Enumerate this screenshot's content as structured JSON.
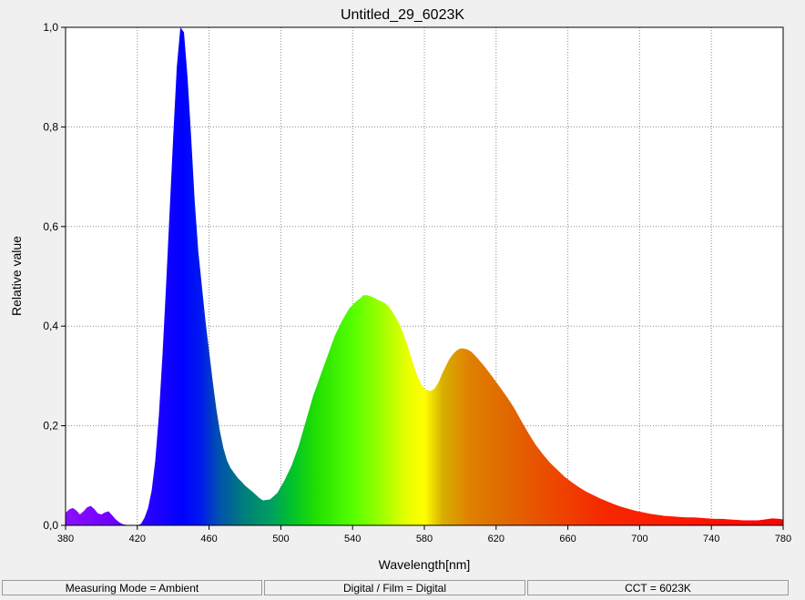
{
  "chart_data": {
    "type": "area",
    "title": "Untitled_29_6023K",
    "xlabel": "Wavelength[nm]",
    "ylabel": "Relative value",
    "xlim": [
      380,
      780
    ],
    "ylim": [
      0,
      1
    ],
    "xticks": [
      380,
      420,
      460,
      500,
      540,
      580,
      620,
      660,
      700,
      740,
      780
    ],
    "xtick_labels": [
      "380",
      "420",
      "460",
      "500",
      "540",
      "580",
      "620",
      "660",
      "700",
      "740",
      "780"
    ],
    "yticks": [
      0,
      0.2,
      0.4,
      0.6,
      0.8,
      1.0
    ],
    "ytick_labels": [
      "0,0",
      "0,2",
      "0,4",
      "0,6",
      "0,8",
      "1,0"
    ],
    "grid": true,
    "fill": "spectral colors by wavelength",
    "series": [
      {
        "x": [
          380,
          382,
          384,
          386,
          388,
          390,
          392,
          394,
          396,
          398,
          400,
          402,
          404,
          406,
          408,
          410,
          412,
          414,
          416,
          418,
          420,
          422,
          424,
          426,
          428,
          430,
          432,
          434,
          436,
          438,
          440,
          442,
          444,
          446,
          448,
          450,
          452,
          454,
          456,
          458,
          460,
          462,
          464,
          466,
          468,
          470,
          472,
          474,
          476,
          478,
          480,
          484,
          488,
          490,
          494,
          498,
          502,
          506,
          510,
          514,
          518,
          522,
          526,
          530,
          534,
          538,
          542,
          544,
          546,
          548,
          550,
          552,
          554,
          556,
          558,
          560,
          562,
          564,
          566,
          568,
          570,
          572,
          574,
          576,
          578,
          580,
          582,
          584,
          586,
          588,
          590,
          592,
          594,
          596,
          598,
          600,
          602,
          604,
          606,
          608,
          610,
          614,
          618,
          622,
          626,
          630,
          634,
          638,
          642,
          646,
          650,
          654,
          658,
          662,
          666,
          670,
          674,
          678,
          682,
          686,
          690,
          694,
          698,
          702,
          706,
          710,
          714,
          718,
          722,
          726,
          730,
          734,
          738,
          742,
          746,
          750,
          754,
          758,
          762,
          766,
          770,
          774,
          778,
          780
        ],
        "y": [
          0.025,
          0.032,
          0.035,
          0.03,
          0.022,
          0.028,
          0.036,
          0.039,
          0.033,
          0.024,
          0.022,
          0.026,
          0.028,
          0.02,
          0.012,
          0.006,
          0.002,
          0.001,
          0.0,
          0.001,
          0.0,
          0.003,
          0.015,
          0.035,
          0.07,
          0.13,
          0.22,
          0.34,
          0.48,
          0.63,
          0.78,
          0.92,
          1.0,
          0.99,
          0.9,
          0.78,
          0.65,
          0.55,
          0.48,
          0.41,
          0.35,
          0.29,
          0.235,
          0.19,
          0.155,
          0.13,
          0.115,
          0.105,
          0.095,
          0.088,
          0.08,
          0.068,
          0.055,
          0.05,
          0.052,
          0.065,
          0.09,
          0.12,
          0.16,
          0.21,
          0.26,
          0.3,
          0.34,
          0.38,
          0.41,
          0.435,
          0.45,
          0.455,
          0.462,
          0.462,
          0.46,
          0.457,
          0.453,
          0.45,
          0.446,
          0.44,
          0.43,
          0.418,
          0.405,
          0.388,
          0.368,
          0.345,
          0.322,
          0.301,
          0.285,
          0.274,
          0.271,
          0.27,
          0.276,
          0.288,
          0.305,
          0.32,
          0.334,
          0.344,
          0.351,
          0.355,
          0.355,
          0.353,
          0.349,
          0.342,
          0.334,
          0.317,
          0.298,
          0.278,
          0.258,
          0.236,
          0.21,
          0.185,
          0.162,
          0.143,
          0.126,
          0.112,
          0.098,
          0.087,
          0.077,
          0.068,
          0.061,
          0.054,
          0.048,
          0.042,
          0.037,
          0.033,
          0.029,
          0.026,
          0.023,
          0.021,
          0.019,
          0.018,
          0.017,
          0.016,
          0.016,
          0.015,
          0.014,
          0.013,
          0.013,
          0.012,
          0.011,
          0.01,
          0.01,
          0.01,
          0.012,
          0.014,
          0.013,
          0.012
        ]
      }
    ]
  },
  "status": {
    "mode": "Measuring Mode = Ambient",
    "digital": "Digital / Film = Digital",
    "cct": "CCT = 6023K"
  }
}
